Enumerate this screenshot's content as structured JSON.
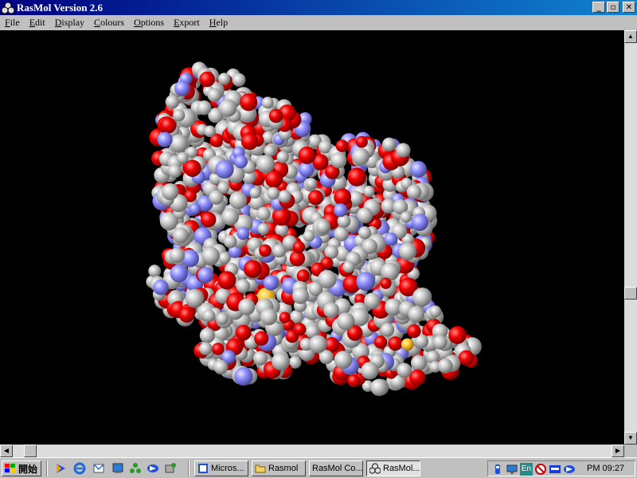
{
  "window": {
    "title": "RasMol Version 2.6"
  },
  "window_controls": {
    "minimize": "_",
    "maximize": "▫",
    "close": "✕"
  },
  "menu": {
    "items": [
      "File",
      "Edit",
      "Display",
      "Colours",
      "Options",
      "Export",
      "Help"
    ]
  },
  "taskbar": {
    "start_label": "開始",
    "tasks": [
      "Micros...",
      "Rasmol",
      "RasMol Co...",
      "RasMol..."
    ],
    "active_task": "RasMol...",
    "tray_lang": "En",
    "clock": "PM 09:27"
  },
  "colors": {
    "carbon": "#c8c8c8",
    "oxygen": "#f00000",
    "nitrogen": "#8f8fff",
    "sulfur": "#ffc832",
    "background": "#000000",
    "title_gradient_start": "#00007f",
    "title_gradient_end": "#1084d0"
  }
}
